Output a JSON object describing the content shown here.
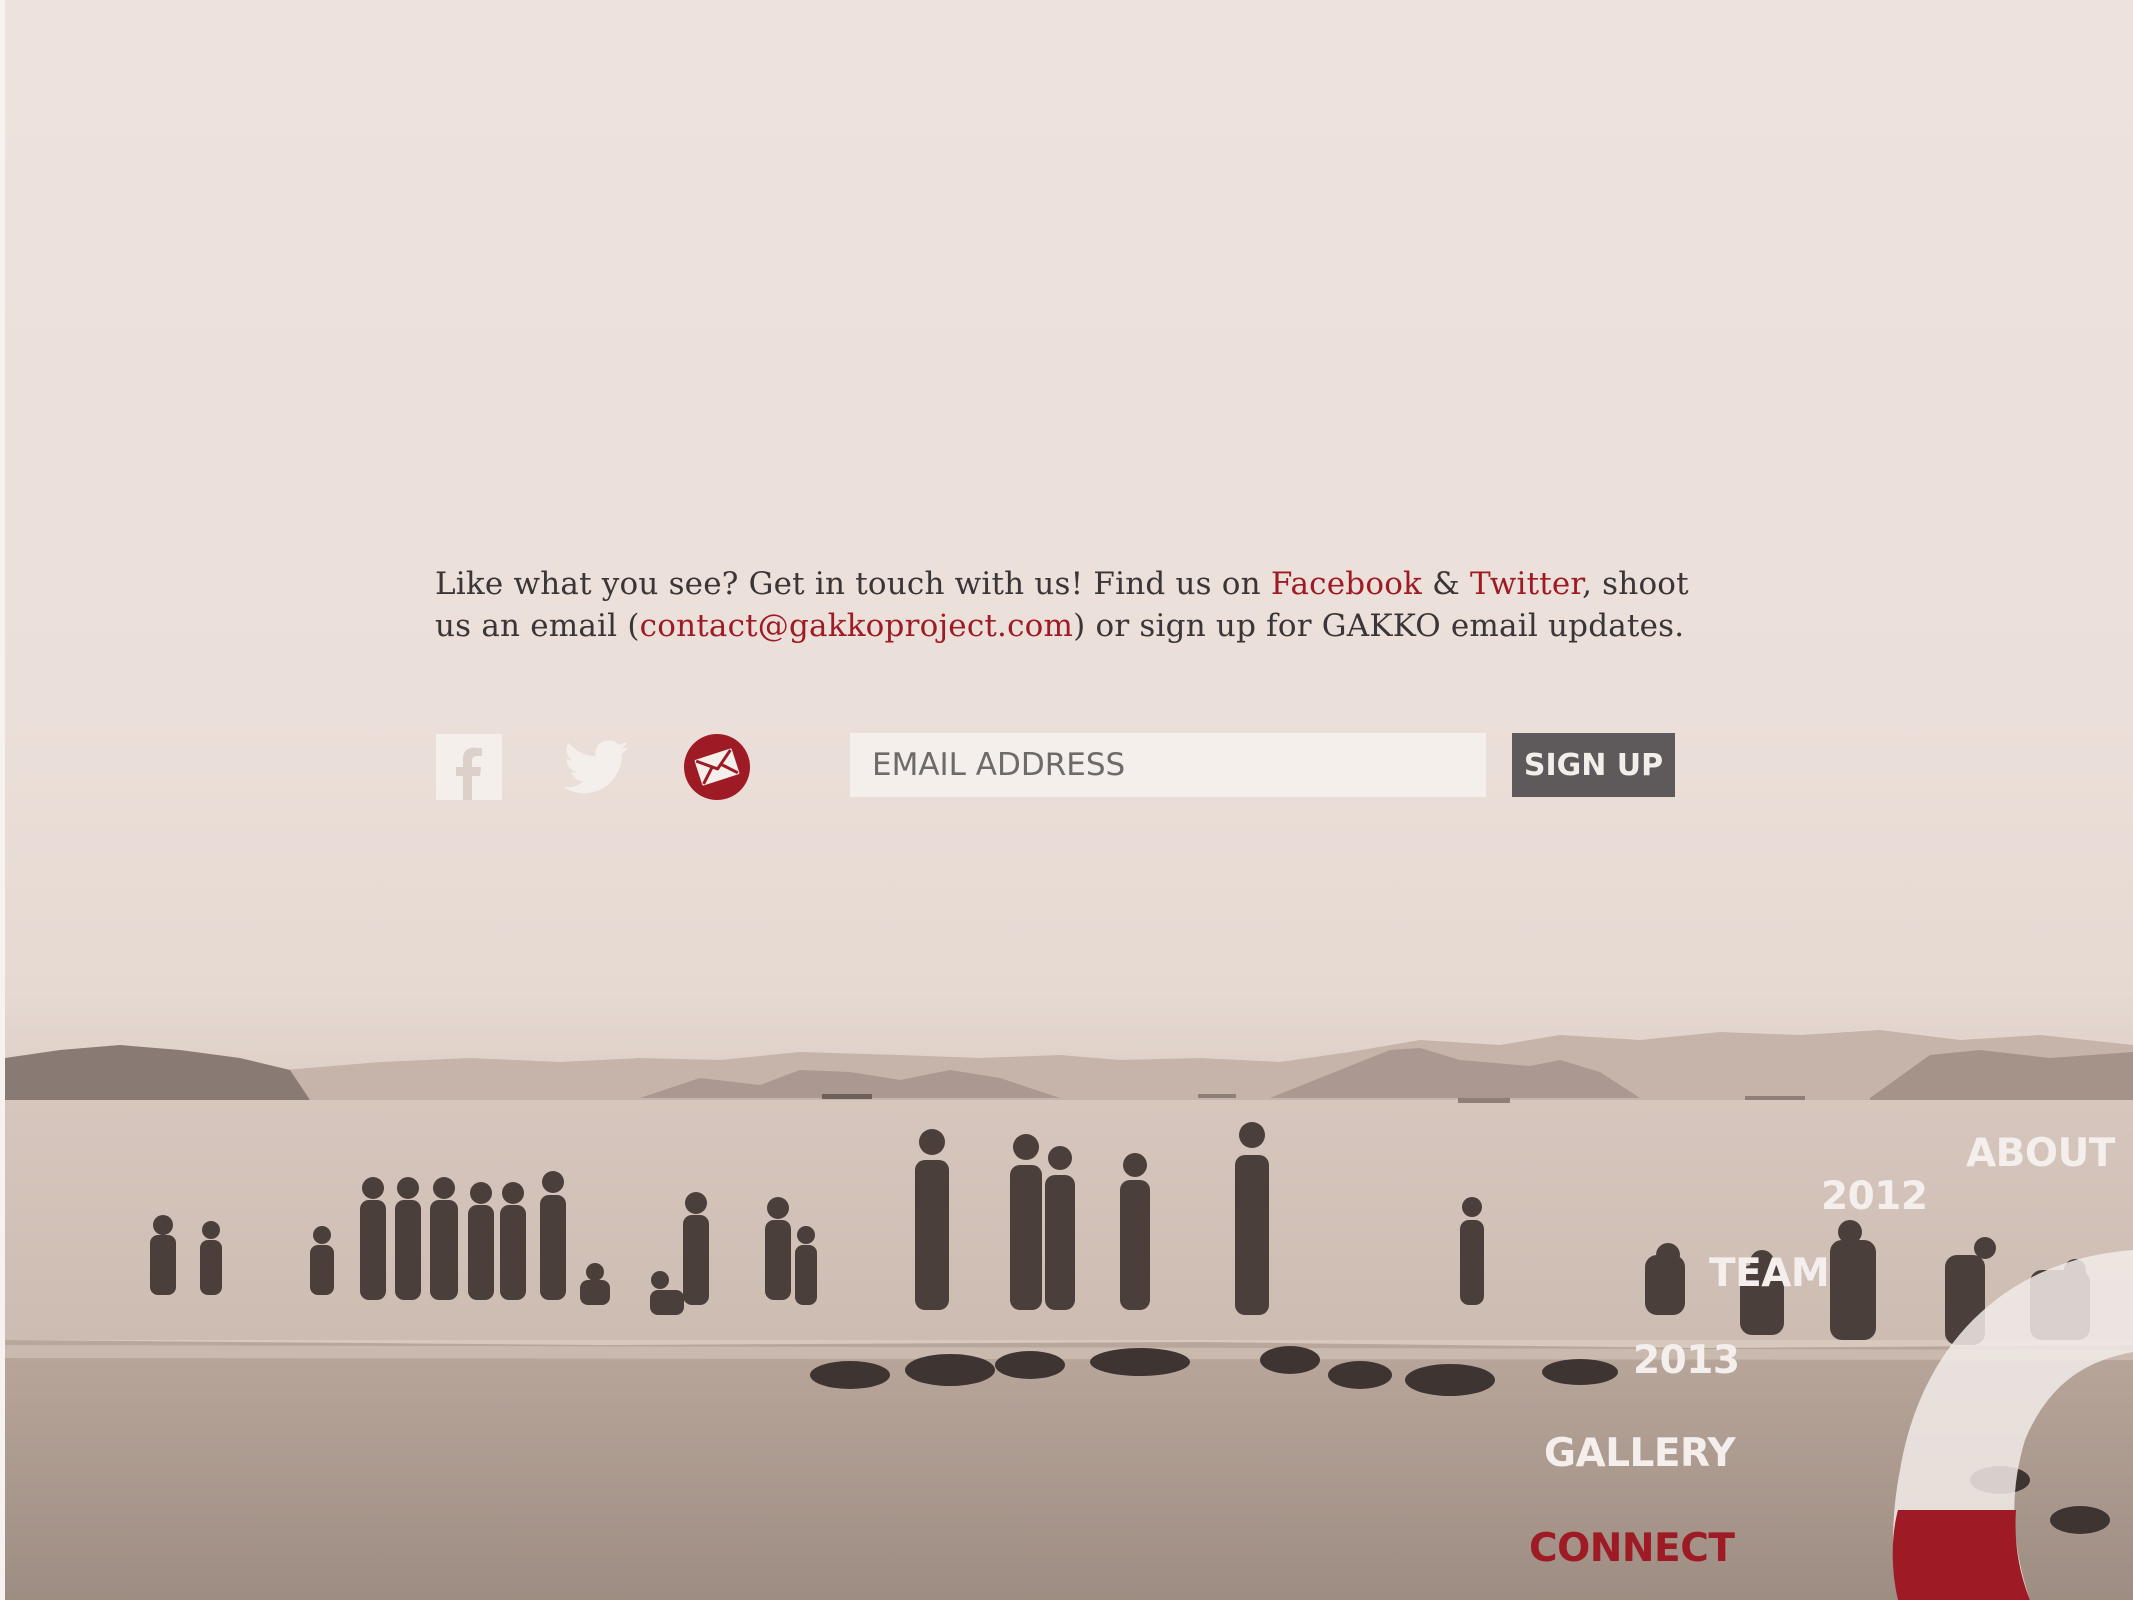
{
  "intro": {
    "part1": "Like what you see? Get in touch with us! Find us on ",
    "facebook_link": "Facebook",
    "amp": " & ",
    "twitter_link": "Twitter",
    "part2": ", shoot us an email (",
    "email_link": "contact@gakkoproject.com",
    "part3": ") or sign up for GAKKO email updates."
  },
  "social": {
    "facebook_icon": "facebook-icon",
    "twitter_icon": "twitter-icon",
    "mail_icon": "envelope-icon"
  },
  "signup": {
    "placeholder": "EMAIL ADDRESS",
    "button_label": "SIGN UP"
  },
  "nav": {
    "items": [
      {
        "label": "ABOUT"
      },
      {
        "label": "2012"
      },
      {
        "label": "TEAM"
      },
      {
        "label": "2013"
      },
      {
        "label": "GALLERY"
      },
      {
        "label": "CONNECT"
      }
    ],
    "active": "CONNECT"
  },
  "colors": {
    "accent": "#9e1b25",
    "button": "#5e5a5b",
    "text": "#3a3536",
    "background": "#ede2dd"
  }
}
